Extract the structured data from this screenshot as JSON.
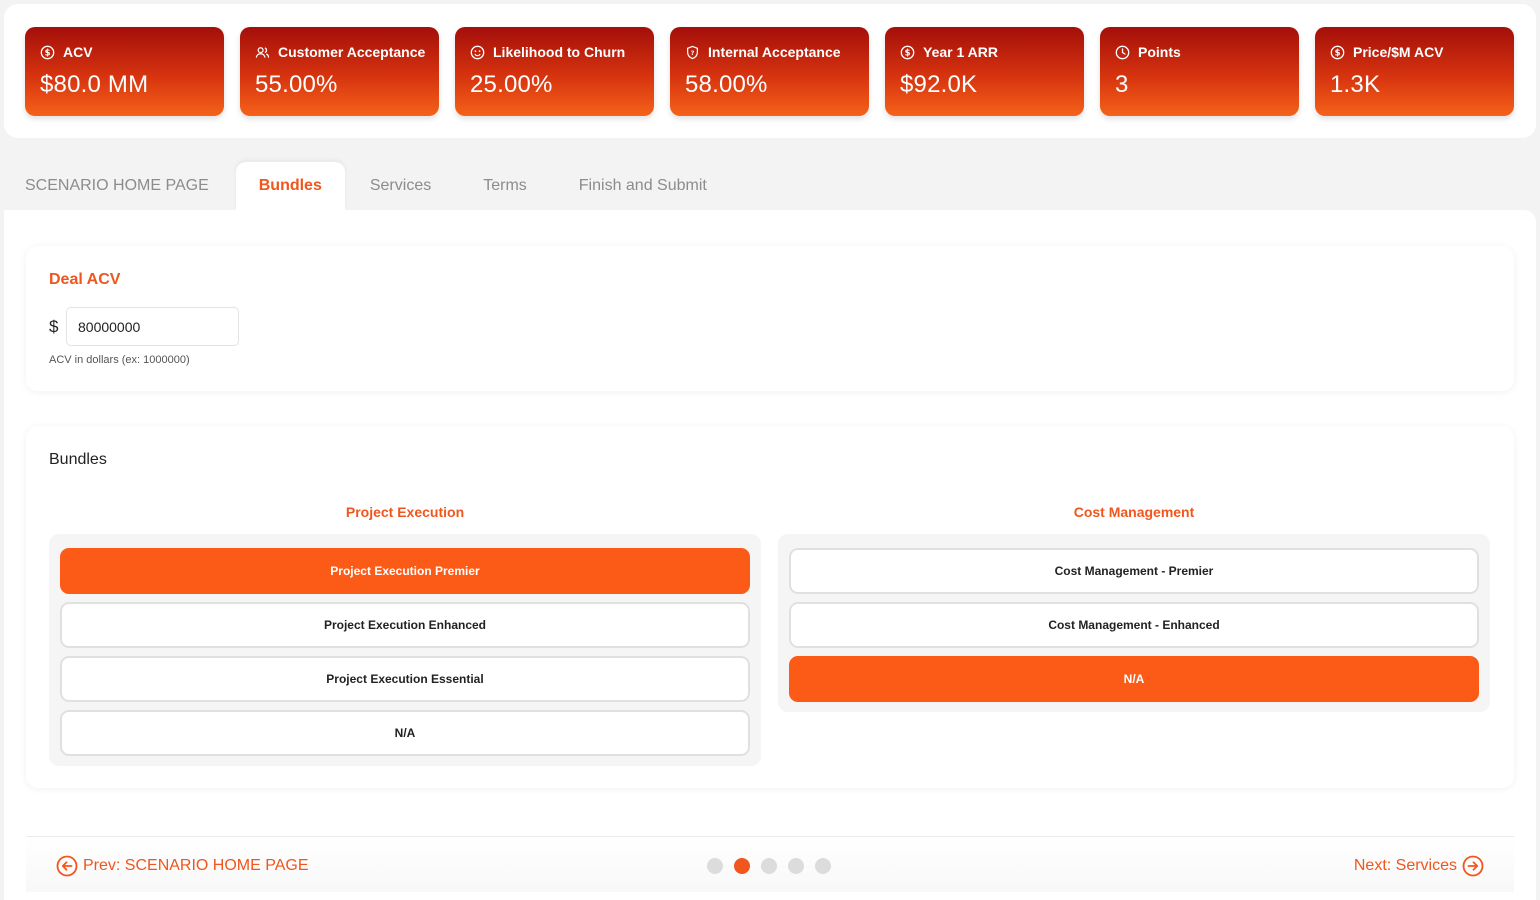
{
  "kpis": [
    {
      "icon": "dollar-circle-icon",
      "label": "ACV",
      "value": "$80.0 MM"
    },
    {
      "icon": "users-icon",
      "label": "Customer Acceptance",
      "value": "55.00%"
    },
    {
      "icon": "smiley-icon",
      "label": "Likelihood to Churn",
      "value": "25.00%"
    },
    {
      "icon": "shield-icon",
      "label": "Internal Acceptance",
      "value": "58.00%"
    },
    {
      "icon": "dollar-circle-icon",
      "label": "Year 1 ARR",
      "value": "$92.0K"
    },
    {
      "icon": "clock-icon",
      "label": "Points",
      "value": "3"
    },
    {
      "icon": "dollar-circle-icon",
      "label": "Price/$M ACV",
      "value": "1.3K"
    }
  ],
  "tabs": [
    {
      "label": "SCENARIO HOME PAGE",
      "active": false
    },
    {
      "label": "Bundles",
      "active": true
    },
    {
      "label": "Services",
      "active": false
    },
    {
      "label": "Terms",
      "active": false
    },
    {
      "label": "Finish and Submit",
      "active": false
    }
  ],
  "deal": {
    "title": "Deal ACV",
    "currency": "$",
    "value": "80000000",
    "hint": "ACV in dollars (ex: 1000000)"
  },
  "bundles": {
    "title": "Bundles",
    "groups": [
      {
        "title": "Project Execution",
        "options": [
          {
            "label": "Project Execution Premier",
            "selected": true
          },
          {
            "label": "Project Execution Enhanced",
            "selected": false
          },
          {
            "label": "Project Execution Essential",
            "selected": false
          },
          {
            "label": "N/A",
            "selected": false
          }
        ]
      },
      {
        "title": "Cost Management",
        "options": [
          {
            "label": "Cost Management - Premier",
            "selected": false
          },
          {
            "label": "Cost Management - Enhanced",
            "selected": false
          },
          {
            "label": "N/A",
            "selected": true
          }
        ]
      }
    ]
  },
  "nav": {
    "prev_label": "Prev: SCENARIO HOME PAGE",
    "next_label": "Next: Services",
    "step_count": 5,
    "current_step": 2
  },
  "colors": {
    "accent": "#f0561d",
    "selected_option": "#fc5a17",
    "kpi_gradient_top": "#a40f0a",
    "kpi_gradient_bottom": "#f5621a"
  }
}
